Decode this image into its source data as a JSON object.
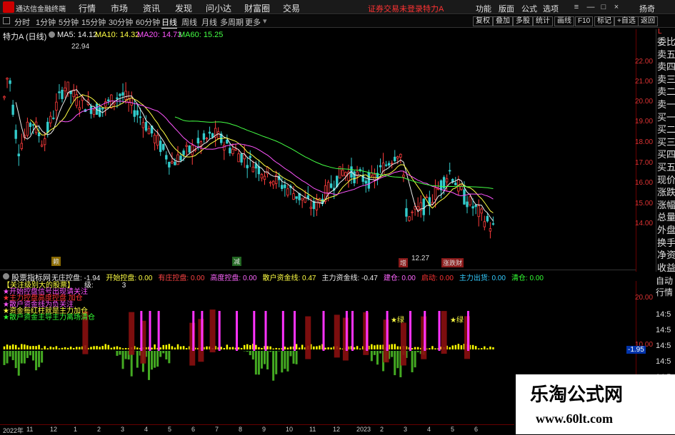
{
  "app": {
    "title": "通达信金融终端"
  },
  "menu": [
    "行情",
    "市场",
    "资讯",
    "发现",
    "问小达",
    "财富圈",
    "交易"
  ],
  "login_status": "证券交易未登录",
  "stock_title": "特力A",
  "right_menu": [
    "功能",
    "版面",
    "公式",
    "选项"
  ],
  "extra": "扬奇",
  "window_controls": [
    "—",
    "□",
    "×"
  ],
  "periods": [
    "分时",
    "1分钟",
    "5分钟",
    "15分钟",
    "30分钟",
    "60分钟",
    "日线",
    "周线",
    "月线",
    "多周期",
    "更多"
  ],
  "active_period": "日线",
  "toolbar_buttons": [
    "复权",
    "叠加",
    "多股",
    "统计",
    "画线",
    "F10",
    "标记",
    "+自选",
    "返回"
  ],
  "price_info": {
    "name": "特力A",
    "period": "(日线)",
    "ma5": "MA5: 14.12",
    "ma10": "MA10: 14.32",
    "ma20": "MA20: 14.73",
    "ma60": "MA60: 15.25"
  },
  "chart_labels": {
    "high": "22.94",
    "low": "12.27"
  },
  "markers": [
    "赖",
    "减",
    "增",
    "涨跌财"
  ],
  "indicator_bar": {
    "name": "股票指标网",
    "items": [
      {
        "label": "无庄控盘: -1.94",
        "color": "#eeeeee"
      },
      {
        "label": "开始控盘: 0.00",
        "color": "#ffff44"
      },
      {
        "label": "有庄控盘: 0.00",
        "color": "#ff4444"
      },
      {
        "label": "高度控盘: 0.00",
        "color": "#ff66ff"
      },
      {
        "label": "散户资金线: 0.47",
        "color": "#ffff44"
      },
      {
        "label": "主力资金线: -0.47",
        "color": "#eeeeee"
      },
      {
        "label": "建仓: 0.00",
        "color": "#ff66ff"
      },
      {
        "label": "启动: 0.00",
        "color": "#ff3333"
      },
      {
        "label": "主力出货: 0.00",
        "color": "#33ccff"
      },
      {
        "label": "清仓: 0.00",
        "color": "#33ff33"
      }
    ]
  },
  "indicator_text": {
    "title": "【关注级别大的股票】",
    "level_label": "级:",
    "level_value": "3",
    "lines": [
      "★开始控盘信号出现请关注",
      "★主力控盘高度控盘 加仓",
      "★散户资金线为负关注",
      "★资金每红柱就是主力加仓",
      "★散户资金主导主力离场清仓"
    ],
    "star1": "★绿",
    "star2": "★绿"
  },
  "y_axis": [
    "22.00",
    "21.00",
    "20.00",
    "19.00",
    "18.00",
    "17.00",
    "16.00",
    "15.00",
    "14.00"
  ],
  "y_axis2": [
    "20.00",
    "10.00",
    "-1.95"
  ],
  "side_panel": [
    "委比",
    "卖五",
    "卖四",
    "卖三",
    "卖二",
    "卖一",
    "买一",
    "买二",
    "买三",
    "买四",
    "买五",
    "现价",
    "涨跌",
    "涨幅",
    "总量",
    "外盘",
    "换手",
    "净资",
    "收益"
  ],
  "side_panel2": [
    "自动",
    "行情"
  ],
  "time_list": [
    "14:5",
    "14:5",
    "14:5",
    "14:5",
    "14:5",
    "14:5",
    "14:5"
  ],
  "time_axis": [
    "2022年",
    "11",
    "12",
    "1",
    "2",
    "3",
    "4",
    "5",
    "6",
    "7",
    "8",
    "9",
    "10",
    "11",
    "12",
    "2023",
    "2",
    "3",
    "4",
    "5",
    "6"
  ],
  "watermark": {
    "line1": "乐淘公式网",
    "line2": "www.60lt.com"
  }
}
